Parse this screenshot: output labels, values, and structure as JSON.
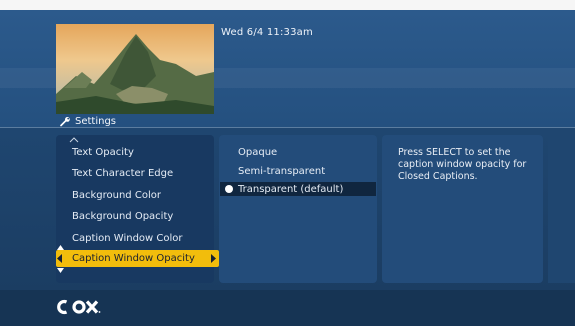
{
  "header": {
    "datetime": "Wed 6/4  11:33am",
    "thumbnail": "mountain-landscape-thumbnail"
  },
  "section": {
    "title": "Settings",
    "icon": "wrench-icon"
  },
  "menu": {
    "items": [
      {
        "label": "Text Opacity"
      },
      {
        "label": "Text Character Edge"
      },
      {
        "label": "Background Color"
      },
      {
        "label": "Background Opacity"
      },
      {
        "label": "Caption Window Color"
      }
    ],
    "selected": {
      "label": "Caption Window Opacity"
    }
  },
  "options": {
    "items": [
      {
        "label": "Opaque"
      },
      {
        "label": "Semi-transparent"
      }
    ],
    "selected": {
      "label": "Transparent (default)"
    }
  },
  "help": {
    "text": "Press SELECT to set the caption window opacity for Closed Captions."
  },
  "footer": {
    "logo": "COX"
  },
  "colors": {
    "highlight": "#f2bd0c",
    "background": "#1f4670",
    "panel": "#234c7a"
  }
}
